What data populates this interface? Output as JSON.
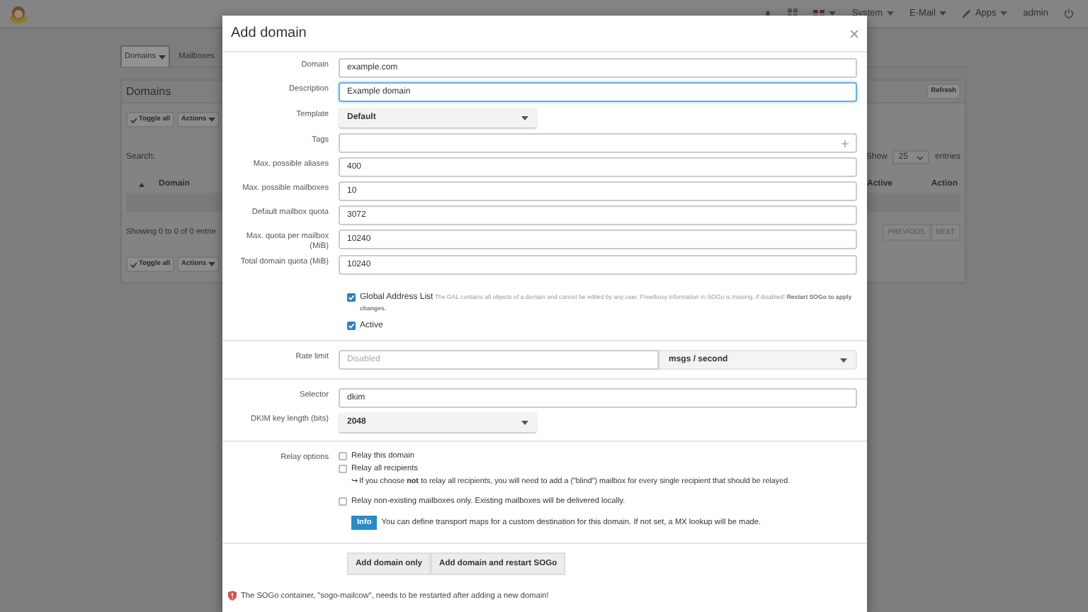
{
  "navbar": {
    "items": [
      {
        "label": "System",
        "kind": "menu"
      },
      {
        "label": "E-Mail",
        "kind": "menu"
      },
      {
        "label": "Apps",
        "kind": "apps"
      },
      {
        "label": "admin",
        "kind": "user"
      }
    ]
  },
  "page": {
    "tabs": [
      {
        "label": "Domains",
        "selected": true
      },
      {
        "label": "Mailboxes",
        "selected": false
      }
    ],
    "panel_title": "Domains",
    "refresh": "Refresh",
    "toolbar": [
      {
        "label": "Toggle all",
        "kind": "toggle"
      },
      {
        "label": "Actions",
        "kind": "menu"
      }
    ],
    "search_label": "Search:",
    "show": "Show",
    "show_value": "25",
    "entries": "entries",
    "columns": [
      "Domain",
      "Active",
      "Action"
    ],
    "info": "Showing 0 to 0 of 0 entrie",
    "pager": [
      "PREVIOUS",
      "NEXT"
    ],
    "bottom_toolbar": [
      {
        "label": "Toggle all",
        "kind": "toggle"
      },
      {
        "label": "Actions",
        "kind": "menu"
      }
    ]
  },
  "modal": {
    "title": "Add domain",
    "fields": [
      {
        "kind": "text",
        "label": "Domain",
        "value": "example.com",
        "focused": false
      },
      {
        "kind": "text",
        "label": "Description",
        "value": "Example domain",
        "focused": true
      },
      {
        "kind": "select",
        "label": "Template",
        "value": "Default"
      },
      {
        "kind": "tags",
        "label": "Tags"
      },
      {
        "kind": "text",
        "label": "Max. possible aliases",
        "value": "400",
        "focused": false
      },
      {
        "kind": "text",
        "label": "Max. possible mailboxes",
        "value": "10",
        "focused": false
      },
      {
        "kind": "text",
        "label": "Default mailbox quota",
        "value": "3072",
        "focused": false
      },
      {
        "kind": "text",
        "label": "Max. quota per mailbox (MiB)",
        "value": "10240",
        "focused": false
      },
      {
        "kind": "text",
        "label": "Total domain quota (MiB)",
        "value": "10240",
        "focused": false
      }
    ],
    "flags": [
      {
        "label": "Global Address List",
        "note": "The GAL contains all objects of a domain and cannot be edited by any user. Free/busy information in SOGo is missing, if disabled! **Restart SOGo to apply changes.**",
        "checked": true
      },
      {
        "label": "Active",
        "checked": true
      }
    ],
    "rate_limit": {
      "label": "Rate limit",
      "placeholder": "Disabled",
      "unit": "msgs / second"
    },
    "dkim_fields": [
      {
        "kind": "text",
        "label": "Selector",
        "value": "dkim",
        "focused": false
      },
      {
        "kind": "select",
        "label": "DKIM key length (bits)",
        "value": "2048"
      }
    ],
    "relay": {
      "label": "Relay options",
      "options": [
        {
          "label": "Relay this domain",
          "checked": false
        },
        {
          "label": "Relay all recipients",
          "checked": false,
          "hint": "↪ If you choose **not** to relay all recipients, you will need to add a (\"blind\") mailbox for every single recipient that should be relayed."
        },
        {
          "label": "Relay non-existing mailboxes only. Existing mailboxes will be delivered locally.",
          "checked": false
        }
      ],
      "info": {
        "badge": "Info",
        "text": "You can define transport maps for a custom destination for this domain. If not set, a MX lookup will be made."
      }
    },
    "buttons": [
      "Add domain only",
      "Add domain and restart SOGo"
    ],
    "warning": "The SOGo container, \"sogo-mailcow\", needs to be restarted after adding a new domain!"
  }
}
